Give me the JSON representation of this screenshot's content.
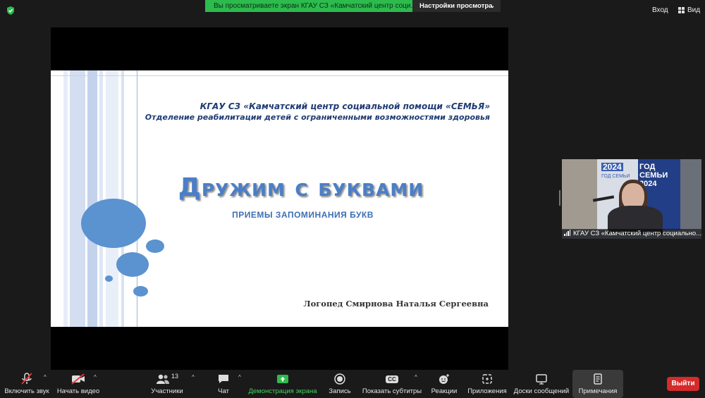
{
  "top_bar": {
    "share_banner": "Вы просматриваете экран КГАУ СЗ «Камчатский центр соци...",
    "view_settings": "Настройки просмотра",
    "enter_label": "Вход",
    "view_label": "Вид"
  },
  "slide": {
    "org_line1": "КГАУ СЗ «Камчатский центр социальной помощи «СЕМЬЯ»",
    "org_line2": "Отделение реабилитации детей с ограниченными возможностями здоровья",
    "title": "Дружим с буквами",
    "subtitle": "ПРИЕМЫ ЗАПОМИНАНИЯ БУКВ",
    "author": "Логопед Смирнова Наталья Сергеевна"
  },
  "participant": {
    "name": "КГАУ СЗ «Камчатский центр социально...",
    "banner_text1": "ГОД",
    "banner_text2": "СЕМЬИ",
    "banner_text3": "2024",
    "board_year": "2024",
    "board_caption": "ГОД СЕМЬИ"
  },
  "toolbar": {
    "mute": "Включить звук",
    "video": "Начать видео",
    "participants": "Участники",
    "participants_count": "13",
    "chat": "Чат",
    "share": "Демонстрация экрана",
    "record": "Запись",
    "captions": "Показать субтитры",
    "captions_icon": "CC",
    "reactions": "Реакции",
    "apps": "Приложения",
    "whiteboards": "Доски сообщений",
    "notes": "Примечания",
    "leave": "Выйти"
  },
  "colors": {
    "share_green": "#2dbb4e",
    "slide_title_blue": "#4a7fc7",
    "leave_red": "#d42b2b"
  }
}
